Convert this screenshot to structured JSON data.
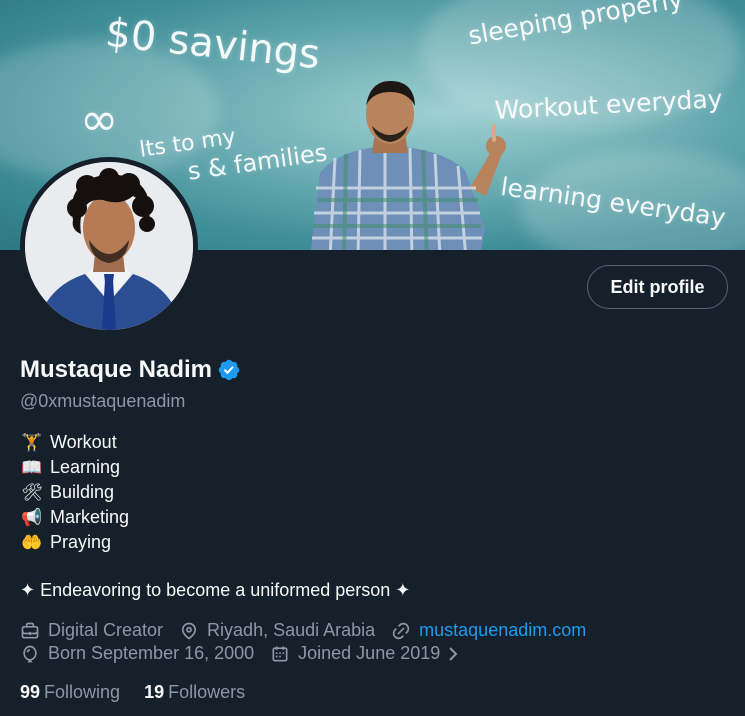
{
  "banner": {
    "texts": {
      "savings": "$0 savings",
      "sleeping": "sleeping properly",
      "workout": "Workout everyday",
      "learning": "learning everyday",
      "infinity": "∞",
      "to_my": "lts to my",
      "families": "s & families"
    }
  },
  "profile": {
    "name": "Mustaque Nadim",
    "handle": "@0xmustaquenadim",
    "verified_icon": "verified-badge-icon",
    "edit_button": "Edit profile"
  },
  "bio": {
    "lines": [
      {
        "emoji": "🏋",
        "text": "Workout"
      },
      {
        "emoji": "📖",
        "text": "Learning"
      },
      {
        "emoji": "🛠",
        "text": "Building"
      },
      {
        "emoji": "📢",
        "text": "Marketing"
      },
      {
        "emoji": "🤲",
        "text": "Praying"
      }
    ],
    "tagline": "✦ Endeavoring to become a uniformed person ✦"
  },
  "meta": {
    "category": "Digital Creator",
    "location": "Riyadh, Saudi Arabia",
    "website": "mustaquenadim.com",
    "birthday": "Born September 16, 2000",
    "joined": "Joined June 2019"
  },
  "stats": {
    "following_count": "99",
    "following_label": "Following",
    "followers_count": "19",
    "followers_label": "Followers"
  },
  "colors": {
    "background": "#15202b",
    "text_primary": "#f7f9f9",
    "text_secondary": "#8b98a5",
    "accent": "#1d9bf0",
    "border": "#536471"
  }
}
